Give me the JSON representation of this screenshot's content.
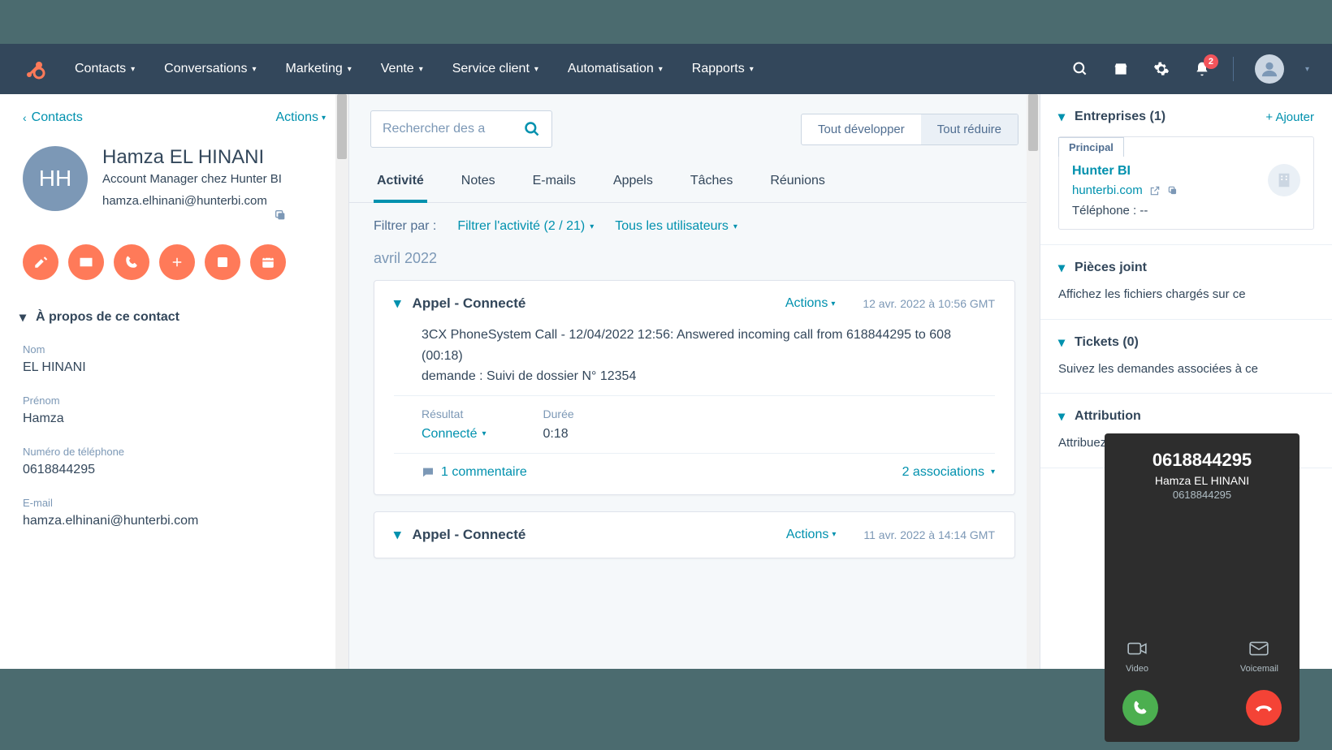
{
  "nav": {
    "items": [
      "Contacts",
      "Conversations",
      "Marketing",
      "Vente",
      "Service client",
      "Automatisation",
      "Rapports"
    ],
    "notif_count": "2"
  },
  "left": {
    "back": "Contacts",
    "actions": "Actions",
    "avatar_initials": "HH",
    "name": "Hamza EL HINANI",
    "title": "Account Manager chez Hunter BI",
    "email": "hamza.elhinani@hunterbi.com",
    "about_header": "À propos de ce contact",
    "fields": {
      "nom_label": "Nom",
      "nom_value": "EL HINANI",
      "prenom_label": "Prénom",
      "prenom_value": "Hamza",
      "phone_label": "Numéro de téléphone",
      "phone_value": "0618844295",
      "email_label": "E-mail",
      "email_value": "hamza.elhinani@hunterbi.com"
    }
  },
  "center": {
    "search_placeholder": "Rechercher des a",
    "expand": "Tout développer",
    "collapse": "Tout réduire",
    "tabs": [
      "Activité",
      "Notes",
      "E-mails",
      "Appels",
      "Tâches",
      "Réunions"
    ],
    "filter_label": "Filtrer par :",
    "filter_activity": "Filtrer l'activité (2 / 21)",
    "filter_users": "Tous les utilisateurs",
    "month": "avril 2022",
    "card1": {
      "title": "Appel - Connecté",
      "actions": "Actions",
      "date": "12 avr. 2022 à 10:56 GMT",
      "body_line1": "3CX PhoneSystem Call - 12/04/2022 12:56: Answered incoming call from 618844295 to 608 (00:18)",
      "body_line2": "demande : Suivi de dossier N° 12354",
      "result_label": "Résultat",
      "result_value": "Connecté",
      "duration_label": "Durée",
      "duration_value": "0:18",
      "comments": "1 commentaire",
      "assoc": "2 associations"
    },
    "card2": {
      "title": "Appel - Connecté",
      "actions": "Actions",
      "date": "11 avr. 2022 à 14:14 GMT"
    }
  },
  "right": {
    "companies_title": "Entreprises (1)",
    "add": "+ Ajouter",
    "principal": "Principal",
    "company_name": "Hunter BI",
    "company_domain": "hunterbi.com",
    "company_phone": "Téléphone : --",
    "attachments_title": "Pièces joint",
    "attachments_text": "Affichez les fichiers chargés sur ce",
    "tickets_title": "Tickets (0)",
    "tickets_text": "Suivez les demandes associées à ce",
    "attribution_title": "Attribution",
    "attribution_text": "Attribuez les c"
  },
  "call": {
    "number": "0618844295",
    "name": "Hamza EL HINANI",
    "sub": "0618844295",
    "video": "Video",
    "voicemail": "Voicemail"
  }
}
